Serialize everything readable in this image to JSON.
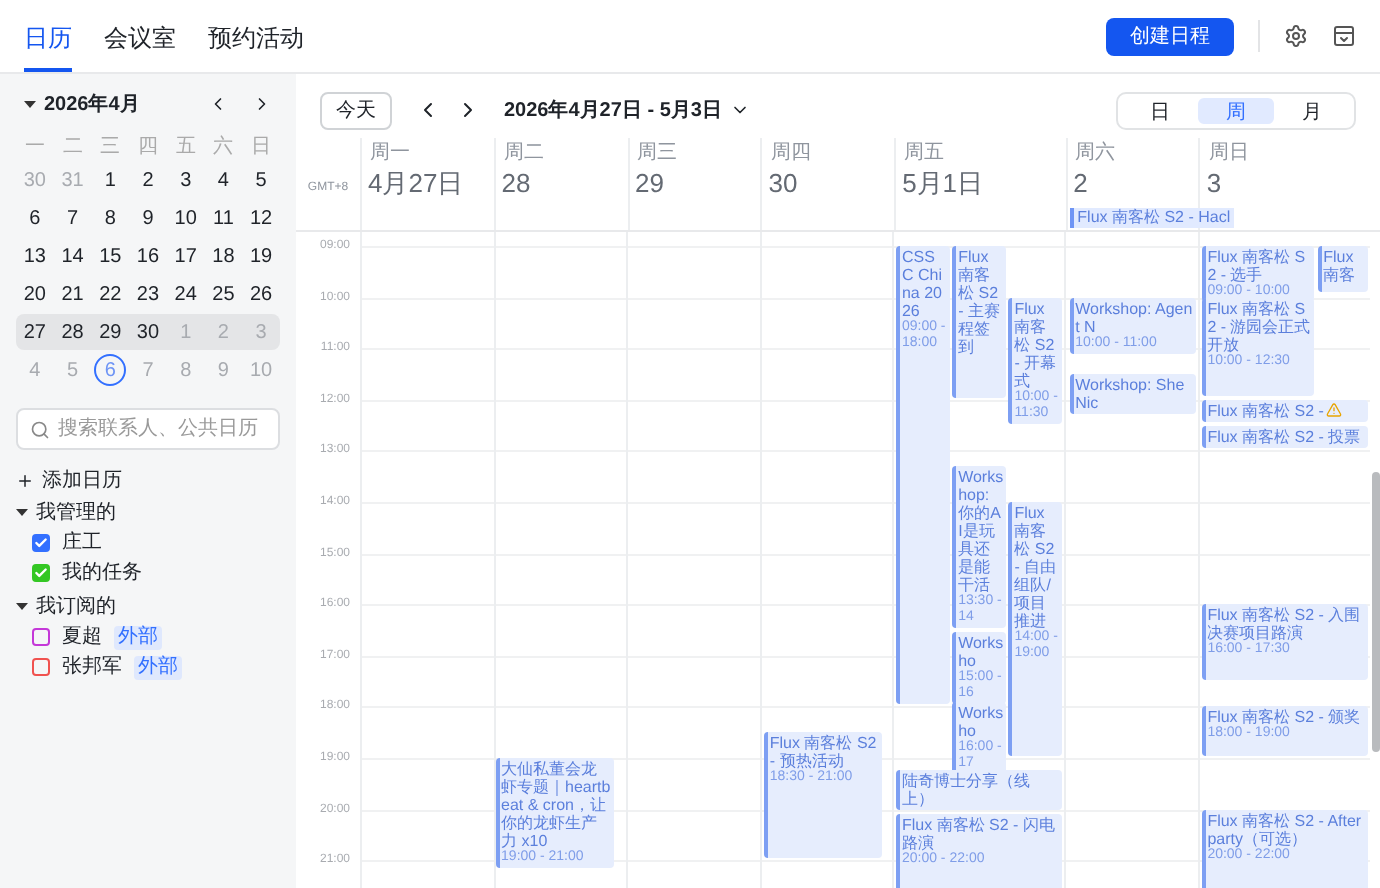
{
  "tabs": [
    {
      "label": "日历",
      "selected": true
    },
    {
      "label": "会议室",
      "selected": false
    },
    {
      "label": "预约活动",
      "selected": false
    }
  ],
  "create_button": "创建日程",
  "mini_calendar": {
    "title": "2026年4月",
    "expanded": true,
    "weekdays": [
      "一",
      "二",
      "三",
      "四",
      "五",
      "六",
      "日"
    ],
    "weeks": [
      {
        "selected": false,
        "days": [
          {
            "label": "30",
            "muted": true,
            "today": false
          },
          {
            "label": "31",
            "muted": true,
            "today": false
          },
          {
            "label": "1",
            "muted": false,
            "today": false
          },
          {
            "label": "2",
            "muted": false,
            "today": false
          },
          {
            "label": "3",
            "muted": false,
            "today": false
          },
          {
            "label": "4",
            "muted": false,
            "today": false
          },
          {
            "label": "5",
            "muted": false,
            "today": false
          }
        ]
      },
      {
        "selected": false,
        "days": [
          {
            "label": "6",
            "muted": false,
            "today": false
          },
          {
            "label": "7",
            "muted": false,
            "today": false
          },
          {
            "label": "8",
            "muted": false,
            "today": false
          },
          {
            "label": "9",
            "muted": false,
            "today": false
          },
          {
            "label": "10",
            "muted": false,
            "today": false
          },
          {
            "label": "11",
            "muted": false,
            "today": false
          },
          {
            "label": "12",
            "muted": false,
            "today": false
          }
        ]
      },
      {
        "selected": false,
        "days": [
          {
            "label": "13",
            "muted": false,
            "today": false
          },
          {
            "label": "14",
            "muted": false,
            "today": false
          },
          {
            "label": "15",
            "muted": false,
            "today": false
          },
          {
            "label": "16",
            "muted": false,
            "today": false
          },
          {
            "label": "17",
            "muted": false,
            "today": false
          },
          {
            "label": "18",
            "muted": false,
            "today": false
          },
          {
            "label": "19",
            "muted": false,
            "today": false
          }
        ]
      },
      {
        "selected": false,
        "days": [
          {
            "label": "20",
            "muted": false,
            "today": false
          },
          {
            "label": "21",
            "muted": false,
            "today": false
          },
          {
            "label": "22",
            "muted": false,
            "today": false
          },
          {
            "label": "23",
            "muted": false,
            "today": false
          },
          {
            "label": "24",
            "muted": false,
            "today": false
          },
          {
            "label": "25",
            "muted": false,
            "today": false
          },
          {
            "label": "26",
            "muted": false,
            "today": false
          }
        ]
      },
      {
        "selected": true,
        "days": [
          {
            "label": "27",
            "muted": false,
            "today": false
          },
          {
            "label": "28",
            "muted": false,
            "today": false
          },
          {
            "label": "29",
            "muted": false,
            "today": false
          },
          {
            "label": "30",
            "muted": false,
            "today": false
          },
          {
            "label": "1",
            "muted": true,
            "today": false
          },
          {
            "label": "2",
            "muted": true,
            "today": false
          },
          {
            "label": "3",
            "muted": true,
            "today": false
          }
        ]
      },
      {
        "selected": false,
        "days": [
          {
            "label": "4",
            "muted": true,
            "today": false
          },
          {
            "label": "5",
            "muted": true,
            "today": false
          },
          {
            "label": "6",
            "muted": true,
            "today": true
          },
          {
            "label": "7",
            "muted": true,
            "today": false
          },
          {
            "label": "8",
            "muted": true,
            "today": false
          },
          {
            "label": "9",
            "muted": true,
            "today": false
          },
          {
            "label": "10",
            "muted": true,
            "today": false
          }
        ]
      }
    ]
  },
  "search": {
    "placeholder": "搜索联系人、公共日历"
  },
  "add_calendar": "添加日历",
  "groups": [
    {
      "title": "我管理的",
      "expanded": true,
      "calendars": [
        {
          "name": "庄工",
          "checked": true,
          "color": "#3370ff"
        },
        {
          "name": "我的任务",
          "checked": true,
          "color": "#34c724"
        }
      ]
    },
    {
      "title": "我订阅的",
      "expanded": true,
      "calendars": [
        {
          "name": "夏超",
          "checked": false,
          "color": "#c438d8",
          "tag": "外部"
        },
        {
          "name": "张邦军",
          "checked": false,
          "color": "#f0524f",
          "tag": "外部"
        }
      ]
    }
  ],
  "toolbar": {
    "today_button": "今天",
    "range": "2026年4月27日 - 5月3日",
    "views": [
      {
        "label": "日",
        "selected": false
      },
      {
        "label": "周",
        "selected": true
      },
      {
        "label": "月",
        "selected": false
      }
    ]
  },
  "timezone": "GMT+8",
  "hours": [
    "09:00",
    "10:00",
    "11:00",
    "12:00",
    "13:00",
    "14:00",
    "15:00",
    "16:00",
    "17:00",
    "18:00",
    "19:00",
    "20:00",
    "21:00"
  ],
  "days": [
    {
      "weekday": "周一",
      "date": "4月27日"
    },
    {
      "weekday": "周二",
      "date": "28",
      "events": [
        {
          "title": "大仙私董会龙虾专题｜heartbeat & cron，让你的龙虾生产力 x10",
          "time": "19:00 - 21:00"
        }
      ]
    },
    {
      "weekday": "周三",
      "date": "29"
    },
    {
      "weekday": "周四",
      "date": "30",
      "events": [
        {
          "title": "Flux 南客松 S2 - 预热活动",
          "time": "18:30 - 21:00"
        }
      ]
    },
    {
      "weekday": "周五",
      "date": "5月1日",
      "events": [
        {
          "title": "CSS C China 2026",
          "time": "09:00 - 18:00"
        },
        {
          "title": "Flux 南客松 S2 - 主赛程签到"
        },
        {
          "title": "Flux 南客松 S2 - 开幕式",
          "time": "10:00 - 11:30"
        },
        {
          "title": "Workshop: 你的AI是玩具还是能干活",
          "time": "13:30 - 14"
        },
        {
          "title": "Flux 南客松 S2 - 自由组队/项目推进",
          "time": "14:00 - 19:00"
        },
        {
          "title": "Worksho",
          "time": "15:00 - 16"
        },
        {
          "title": "Worksho",
          "time": "16:00 - 17"
        },
        {
          "title": "陆奇博士分享（线上）"
        },
        {
          "title": "Flux 南客松 S2 - 闪电路演",
          "time": "20:00 - 22:00"
        }
      ]
    },
    {
      "weekday": "周六",
      "date": "2",
      "all_day": [
        {
          "title": "Flux 南客松 S2 - Hacl"
        }
      ],
      "events": [
        {
          "title": "Workshop: Agent N",
          "time": "10:00 - 11:00"
        },
        {
          "title": "Workshop: She Nic"
        }
      ]
    },
    {
      "weekday": "周日",
      "date": "3",
      "events": [
        {
          "title": "Flux 南客松 S2 - 选手",
          "time": "09:00 - 10:00"
        },
        {
          "title": "Flux 南客"
        },
        {
          "title": "Flux 南客松 S2 - 游园会正式开放",
          "time": "10:00 - 12:30"
        },
        {
          "title": "Flux 南客松 S2 -",
          "warning": true
        },
        {
          "title": "Flux 南客松 S2 - 投票"
        },
        {
          "title": "Flux 南客松 S2 - 入围决赛项目路演",
          "time": "16:00 - 17:30"
        },
        {
          "title": "Flux 南客松 S2 - 颁奖",
          "time": "18:00 - 19:00"
        },
        {
          "title": "Flux 南客松 S2 - Afterparty（可选）",
          "time": "20:00 - 22:00"
        }
      ]
    }
  ]
}
